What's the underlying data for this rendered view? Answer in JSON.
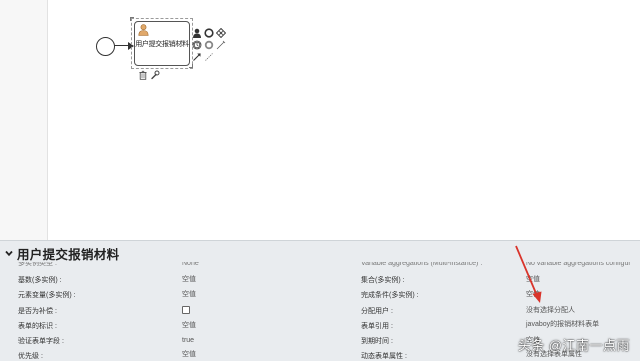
{
  "diagram": {
    "task_label": "用户提交报销材料"
  },
  "panel": {
    "title": "用户提交报销材料",
    "left_column": [
      {
        "label": "多实例类型 :",
        "value": "None"
      },
      {
        "label": "基数(多实例) :",
        "value": "空值"
      },
      {
        "label": "元素变量(多实例) :",
        "value": "空值"
      },
      {
        "label": "是否为补偿 :",
        "value": ""
      },
      {
        "label": "表单的标识 :",
        "value": "空值"
      },
      {
        "label": "验证表单字段 :",
        "value": "true"
      },
      {
        "label": "优先级 :",
        "value": "空值"
      }
    ],
    "right_column": [
      {
        "label": "Variable aggregations (Multi-instance) :",
        "value": "No variable aggregations configured"
      },
      {
        "label": "集合(多实例) :",
        "value": "空值"
      },
      {
        "label": "完成条件(多实例) :",
        "value": "空值"
      },
      {
        "label": "分配用户 :",
        "value": "没有选择分配人"
      },
      {
        "label": "表单引用 :",
        "value": "javaboy的报销材料表单"
      },
      {
        "label": "到期时间 :",
        "value": "空值"
      },
      {
        "label": "动态表单属性 :",
        "value": "没有选择表单属性"
      }
    ]
  },
  "colors": {
    "panel_bg": "#e9ecef",
    "arrow_red": "#d9342b"
  },
  "watermark": "头条 @江南一点雨"
}
